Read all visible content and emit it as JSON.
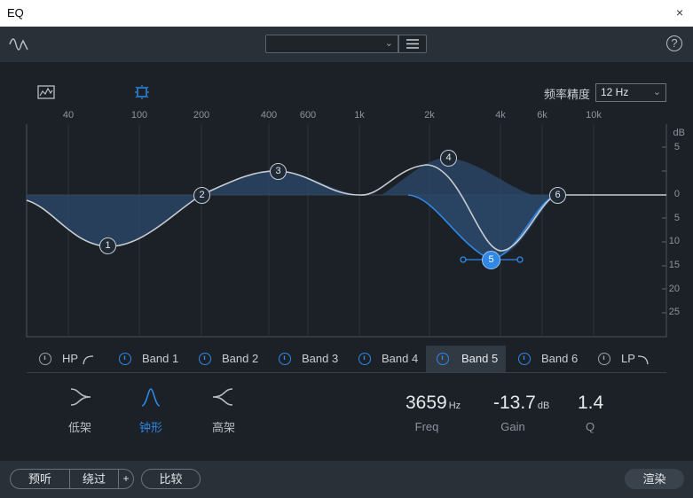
{
  "window": {
    "title": "EQ",
    "close_glyph": "×"
  },
  "toolbar": {
    "logo_icon": "eq-curve-icon",
    "preset_value": "",
    "menu_icon": "hamburger-icon",
    "help_glyph": "?"
  },
  "view_icons": {
    "spectrum": "spectrum-analyzer-icon",
    "nodes": "node-select-icon"
  },
  "precision": {
    "label": "频率精度",
    "value": "12 Hz"
  },
  "graph": {
    "freq_ticks": [
      "40",
      "100",
      "200",
      "400",
      "600",
      "1k",
      "2k",
      "4k",
      "6k",
      "10k"
    ],
    "db_unit": "dB",
    "db_ticks": [
      "5",
      "0",
      "5",
      "10",
      "15",
      "20",
      "25"
    ],
    "nodes": [
      "1",
      "2",
      "3",
      "4",
      "5",
      "6"
    ]
  },
  "bands": [
    {
      "label": "HP",
      "icon": "highpass-curve-icon"
    },
    {
      "label": "Band 1"
    },
    {
      "label": "Band 2"
    },
    {
      "label": "Band 3"
    },
    {
      "label": "Band 4"
    },
    {
      "label": "Band 5"
    },
    {
      "label": "Band 6"
    },
    {
      "label": "LP",
      "icon": "lowpass-curve-icon"
    }
  ],
  "filter_shapes": [
    {
      "label": "低架",
      "icon": "low-shelf-icon"
    },
    {
      "label": "钟形",
      "icon": "bell-icon",
      "selected": true
    },
    {
      "label": "高架",
      "icon": "high-shelf-icon"
    }
  ],
  "params": {
    "freq": {
      "value": "3659",
      "unit": "Hz",
      "label": "Freq"
    },
    "gain": {
      "value": "-13.7",
      "unit": "dB",
      "label": "Gain"
    },
    "q": {
      "value": "1.4",
      "label": "Q"
    }
  },
  "footer": {
    "preview": "预听",
    "bypass": "绕过",
    "plus": "+",
    "compare": "比较",
    "render": "渲染"
  },
  "colors": {
    "accent": "#2f87e6",
    "curve": "#c8ccd2",
    "fill": "#2b4a6e",
    "background": "#1c2127"
  }
}
